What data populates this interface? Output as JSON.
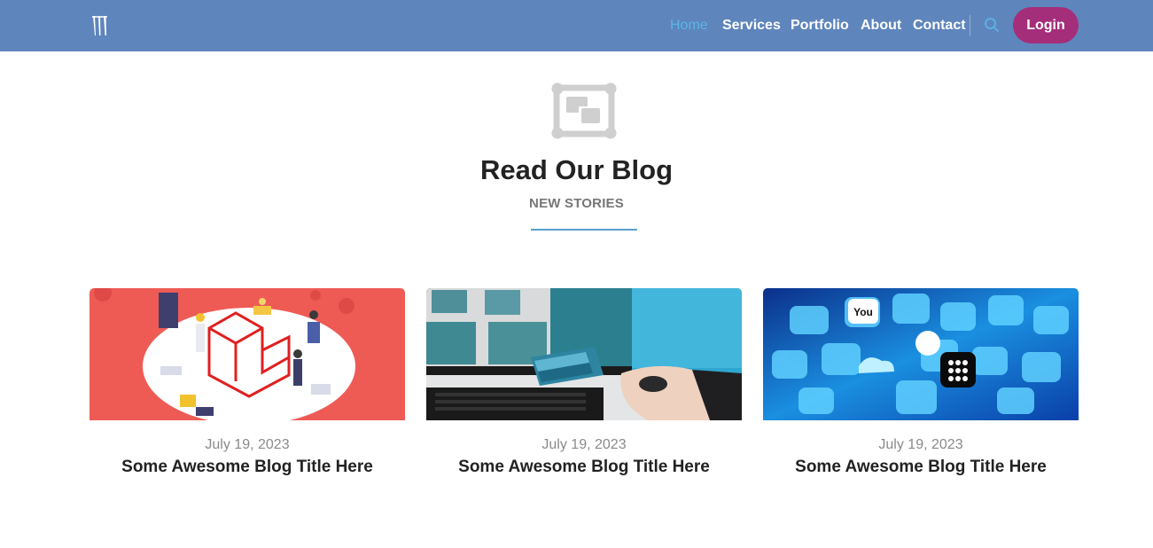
{
  "nav": {
    "logo_icon": "monster-claw-logo-icon",
    "links": [
      {
        "label": "Home",
        "active": true
      },
      {
        "label": "Services",
        "active": false
      },
      {
        "label": "Portfolio",
        "active": false
      },
      {
        "label": "About",
        "active": false
      },
      {
        "label": "Contact",
        "active": false
      }
    ],
    "search_icon": "search-icon",
    "login_label": "Login"
  },
  "section": {
    "icon": "gallery-frame-icon",
    "title": "Read Our Blog",
    "subtitle": "NEW STORIES"
  },
  "posts": [
    {
      "image": "laravel-illustration-image",
      "date": "July 19, 2023",
      "title": "Some Awesome Blog Title Here"
    },
    {
      "image": "computer-color-swatches-image",
      "date": "July 19, 2023",
      "title": "Some Awesome Blog Title Here"
    },
    {
      "image": "social-media-icons-image",
      "date": "July 19, 2023",
      "title": "Some Awesome Blog Title Here"
    }
  ],
  "colors": {
    "navbar": "#5f85bd",
    "active_link": "#5bb5e6",
    "login_button": "#a52e7a",
    "accent_underline": "#5a9fd0"
  }
}
